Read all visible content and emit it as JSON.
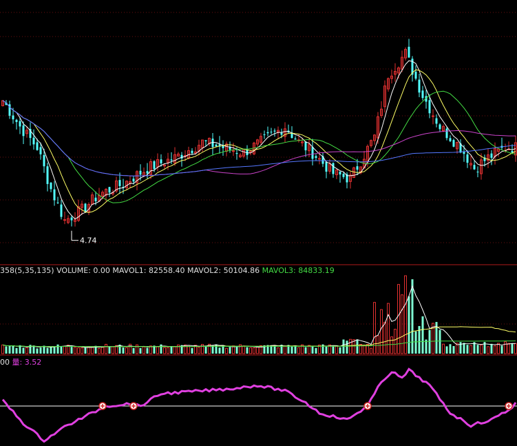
{
  "chart_data": [
    {
      "type": "candlestick",
      "panel": "price",
      "annotation": "4.74",
      "colors": {
        "up": "#e03030",
        "down": "#54ffff",
        "ma5": "#ffffff",
        "ma10": "#ffff66",
        "ma20": "#44dd44",
        "ma60": "#cc44cc",
        "ma120": "#5577ff"
      },
      "anchors": [
        [
          0,
          5.95
        ],
        [
          5,
          5.7
        ],
        [
          10,
          5.5
        ],
        [
          14,
          5.1
        ],
        [
          18,
          4.8
        ],
        [
          23,
          4.9
        ],
        [
          28,
          5.05
        ],
        [
          35,
          5.15
        ],
        [
          42,
          5.3
        ],
        [
          50,
          5.4
        ],
        [
          58,
          5.55
        ],
        [
          64,
          5.5
        ],
        [
          70,
          5.45
        ],
        [
          75,
          5.55
        ],
        [
          82,
          5.7
        ],
        [
          86,
          5.55
        ],
        [
          90,
          5.45
        ],
        [
          96,
          5.25
        ],
        [
          101,
          5.2
        ],
        [
          108,
          5.6
        ],
        [
          112,
          6.2
        ],
        [
          117,
          6.4
        ],
        [
          122,
          6.0
        ],
        [
          127,
          5.7
        ],
        [
          133,
          5.5
        ],
        [
          137,
          5.3
        ],
        [
          141,
          5.4
        ],
        [
          146,
          5.5
        ]
      ]
    },
    {
      "type": "bar",
      "panel": "volume",
      "header": {
        "prefix": "358(5,35,135)",
        "volume": "VOLUME: 0.00",
        "mavol1": "MAVOL1: 82558.40",
        "mavol2": "MAVOL2: 50104.86",
        "mavol3": "MAVOL3: 84833.19"
      },
      "colors": {
        "up": "#e03030",
        "down": "#7fffd4",
        "mavol1": "#ffffff",
        "mavol2": "#ffff66",
        "mavol3": "#44dd44"
      }
    },
    {
      "type": "line",
      "panel": "indicator",
      "header": {
        "prefix": "00",
        "name": "量:",
        "value": "3.52"
      },
      "colors": {
        "line": "#e040e0",
        "baseline": "#ffffff"
      }
    }
  ]
}
